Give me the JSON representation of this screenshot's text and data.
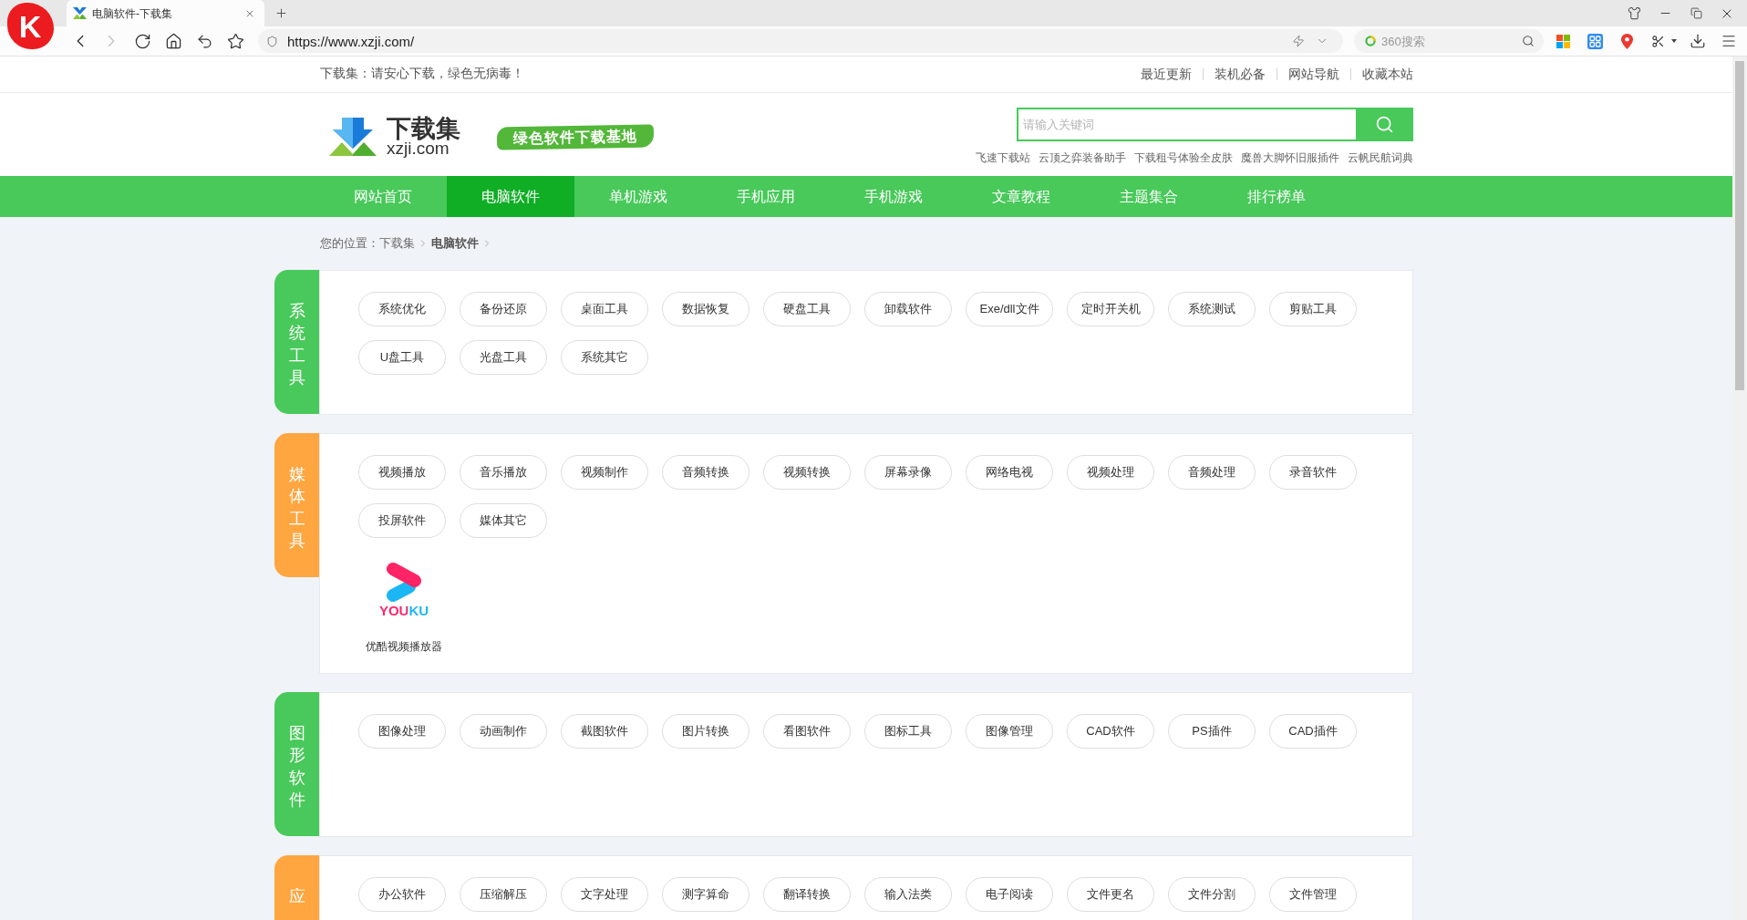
{
  "browser": {
    "logo_letter": "K",
    "tabs": [
      {
        "title": "电脑软件-下载集",
        "selected": true
      }
    ],
    "nav_buttons": [
      {
        "kind": "back",
        "disabled": false
      },
      {
        "kind": "forward",
        "disabled": true
      }
    ],
    "url": "https://www.xzji.com/",
    "search": {
      "placeholder": "360搜索"
    }
  },
  "topbar": {
    "notice": "下载集：请安心下载，绿色无病毒！",
    "links": [
      "最近更新",
      "装机必备",
      "网站导航",
      "收藏本站"
    ]
  },
  "header": {
    "logo_title": "下载集",
    "logo_domain": "xzji.com",
    "slogan": "绿色软件下载基地",
    "search": {
      "placeholder": "请输入关键词"
    },
    "hot_links": [
      "飞速下载站",
      "云顶之弈装备助手",
      "下载租号体验全皮肤",
      "魔兽大脚怀旧服插件",
      "云帆民航词典"
    ]
  },
  "nav": [
    {
      "label": "网站首页",
      "selected": false
    },
    {
      "label": "电脑软件",
      "selected": true
    },
    {
      "label": "单机游戏",
      "selected": false
    },
    {
      "label": "手机应用",
      "selected": false
    },
    {
      "label": "手机游戏",
      "selected": false
    },
    {
      "label": "文章教程",
      "selected": false
    },
    {
      "label": "主题集合",
      "selected": false
    },
    {
      "label": "排行榜单",
      "selected": false
    }
  ],
  "breadcrumb": {
    "prefix": "您的位置：",
    "items": [
      {
        "label": "下载集",
        "current": false
      },
      {
        "label": "电脑软件",
        "current": true
      }
    ]
  },
  "categories": [
    {
      "title": "系统工具",
      "color": "#49c95b",
      "tags": [
        "系统优化",
        "备份还原",
        "桌面工具",
        "数据恢复",
        "硬盘工具",
        "卸载软件",
        "Exe/dll文件",
        "定时开关机",
        "系统测试",
        "剪贴工具",
        "U盘工具",
        "光盘工具",
        "系统其它"
      ]
    },
    {
      "title": "媒体工具",
      "color": "#ffa640",
      "tags": [
        "视频播放",
        "音乐播放",
        "视频制作",
        "音频转换",
        "视频转换",
        "屏幕录像",
        "网络电视",
        "视频处理",
        "音频处理",
        "录音软件",
        "投屏软件",
        "媒体其它"
      ],
      "apps": [
        {
          "name": "优酷视频播放器",
          "logo_text": "YOUKU"
        }
      ]
    },
    {
      "title": "图形软件",
      "color": "#49c95b",
      "tags": [
        "图像处理",
        "动画制作",
        "截图软件",
        "图片转换",
        "看图软件",
        "图标工具",
        "图像管理",
        "CAD软件",
        "PS插件",
        "CAD插件"
      ]
    },
    {
      "title": "应",
      "color": "#ffa640",
      "tags": [
        "办公软件",
        "压缩解压",
        "文字处理",
        "测字算命",
        "翻译转换",
        "输入法类",
        "电子阅读",
        "文件更名",
        "文件分割",
        "文件管理"
      ]
    }
  ]
}
